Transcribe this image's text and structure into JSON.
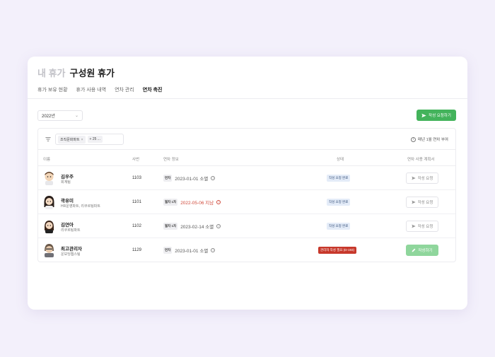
{
  "header": {
    "title_muted": "내 휴가",
    "title_main": "구성원 휴가"
  },
  "tabs": [
    {
      "label": "휴가 보유 현황"
    },
    {
      "label": "휴가 사용 내역"
    },
    {
      "label": "연차 관리"
    },
    {
      "label": "연차 촉진",
      "active": true
    }
  ],
  "year_select": {
    "value": "2022년"
  },
  "request_button": {
    "label": "작성 요청하기"
  },
  "filter": {
    "chips": [
      {
        "label": "조직문화파트",
        "removable": true
      },
      {
        "label": "+ 25 ...",
        "removable": false
      }
    ]
  },
  "notice": "매년 1월 연차 부여",
  "table": {
    "headers": {
      "name": "이름",
      "empno": "사번",
      "leave": "연차 정보",
      "status": "상태",
      "plan": "연차 사용 계획서"
    },
    "rows": [
      {
        "name": "김우주",
        "team": "회계팀",
        "empno": "1103",
        "leave_tag": "연차",
        "leave_text": "2023-01-01 소멸",
        "leave_red": false,
        "status": "작성 요청 완료",
        "status_type": "done",
        "action": "작성 요청",
        "action_type": "outline"
      },
      {
        "name": "곽유미",
        "team": "HR운영파트, 리쿠르팅파트",
        "empno": "1101",
        "leave_tag": "월차 1차",
        "leave_text": "2022-05-06 지남",
        "leave_red": true,
        "status": "작성 요청 완료",
        "status_type": "done",
        "action": "작성 요청",
        "action_type": "outline"
      },
      {
        "name": "김연아",
        "team": "리쿠르팅파트",
        "empno": "1102",
        "leave_tag": "월차 1차",
        "leave_text": "2023-02-14 소멸",
        "leave_red": false,
        "status": "작성 요청 완료",
        "status_type": "done",
        "action": "작성 요청",
        "action_type": "outline"
      },
      {
        "name": "최고관리자",
        "team": "운보딩챕스팀",
        "empno": "1129",
        "leave_tag": "연차",
        "leave_text": "2023-01-01 소멸",
        "leave_red": false,
        "status": "관리자 작성 필요 (D-193)",
        "status_type": "alert",
        "action": "작성하기",
        "action_type": "green"
      }
    ]
  },
  "colors": {
    "accent_green": "#43b35b",
    "alert_red": "#c7382b",
    "background": "#f3f0fb"
  }
}
